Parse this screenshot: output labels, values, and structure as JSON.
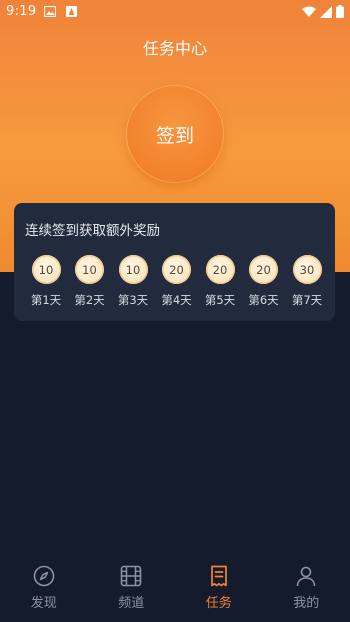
{
  "status_bar": {
    "time": "9:19"
  },
  "header": {
    "title": "任务中心"
  },
  "signin": {
    "label": "签到"
  },
  "reward_card": {
    "title": "连续签到获取额外奖励",
    "days": [
      {
        "coins": "10",
        "label": "第1天"
      },
      {
        "coins": "10",
        "label": "第2天"
      },
      {
        "coins": "10",
        "label": "第3天"
      },
      {
        "coins": "20",
        "label": "第4天"
      },
      {
        "coins": "20",
        "label": "第5天"
      },
      {
        "coins": "20",
        "label": "第6天"
      },
      {
        "coins": "30",
        "label": "第7天"
      }
    ]
  },
  "tabbar": {
    "tabs": [
      {
        "label": "发现",
        "icon": "compass-icon"
      },
      {
        "label": "频道",
        "icon": "film-icon"
      },
      {
        "label": "任务",
        "icon": "task-list-icon",
        "active": true
      },
      {
        "label": "我的",
        "icon": "person-icon"
      }
    ]
  },
  "colors": {
    "accent": "#f2832f",
    "background": "#141b2d",
    "card": "#222b3e",
    "inactive_tab": "#8d93a3"
  }
}
